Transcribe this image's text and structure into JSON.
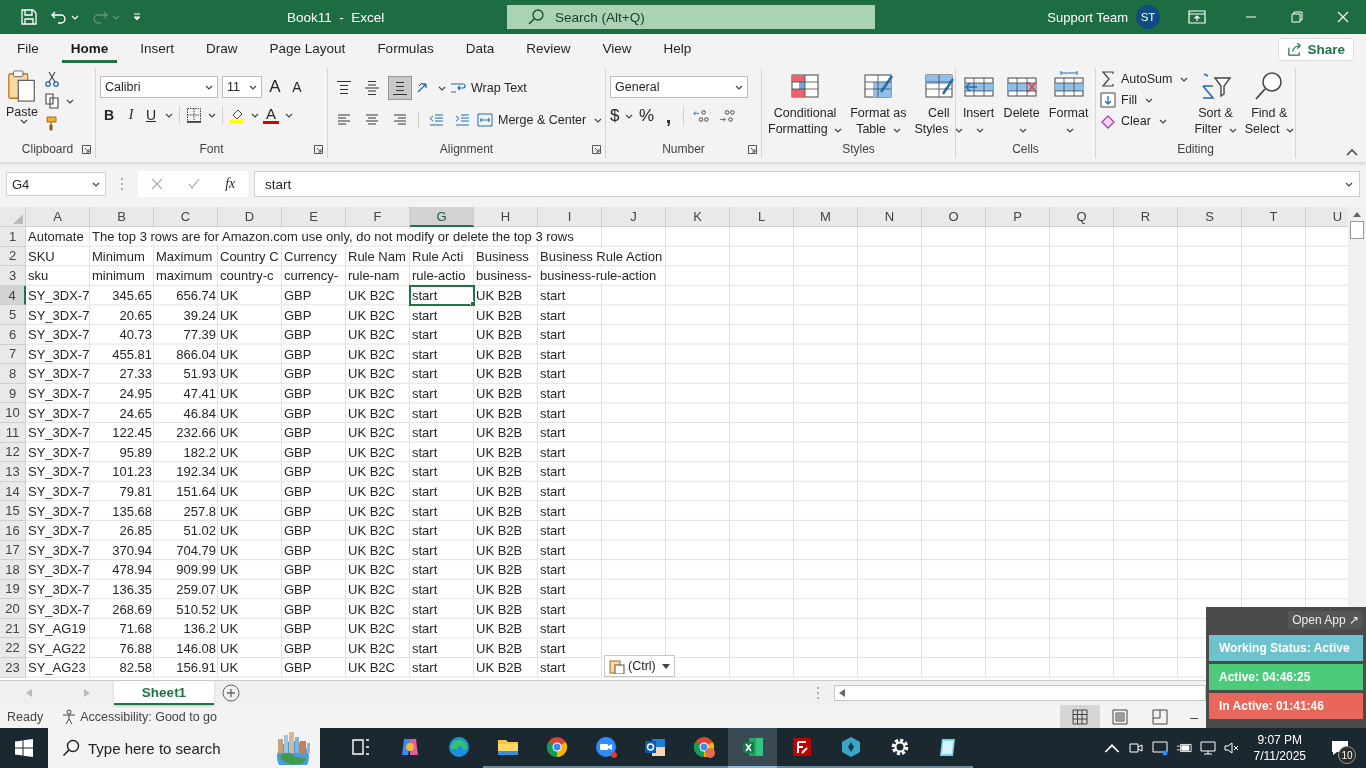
{
  "title_bar": {
    "redo_disabled": true,
    "title": "Book11  -  Excel",
    "search": {
      "placeholder": "Search (Alt+Q)"
    },
    "account": "Support Team",
    "avatar": "ST"
  },
  "ribbon_tabs": [
    {
      "label": "File",
      "selected": false
    },
    {
      "label": "Home",
      "selected": true
    },
    {
      "label": "Insert",
      "selected": false
    },
    {
      "label": "Draw",
      "selected": false
    },
    {
      "label": "Page Layout",
      "selected": false
    },
    {
      "label": "Formulas",
      "selected": false
    },
    {
      "label": "Data",
      "selected": false
    },
    {
      "label": "Review",
      "selected": false
    },
    {
      "label": "View",
      "selected": false
    },
    {
      "label": "Help",
      "selected": false
    }
  ],
  "share": "Share",
  "clipboard": {
    "label": "Clipboard",
    "paste": "Paste"
  },
  "font": {
    "label": "Font",
    "name": "Calibri",
    "size": "11",
    "grow": "A",
    "shrink": "A",
    "bold": "B",
    "italic": "I",
    "underline": "U",
    "font_color": "A"
  },
  "alignment": {
    "label": "Alignment",
    "align_buttons": [
      {
        "kind": "top",
        "selected": false
      },
      {
        "kind": "middle",
        "selected": false
      },
      {
        "kind": "bottom",
        "selected": true
      },
      {
        "kind": "left",
        "selected": false
      },
      {
        "kind": "center",
        "selected": false
      },
      {
        "kind": "right",
        "selected": false
      }
    ],
    "wrap": "Wrap Text",
    "merge": "Merge & Center"
  },
  "number": {
    "label": "Number",
    "format": "General",
    "currency": "$",
    "percent": "%",
    "comma": ","
  },
  "styles": {
    "label": "Styles",
    "buttons": [
      {
        "kind": "conditional",
        "lines": [
          "Conditional",
          "Formatting"
        ]
      },
      {
        "kind": "table",
        "lines": [
          "Format as",
          "Table"
        ]
      },
      {
        "kind": "cell_styles",
        "lines": [
          "Cell",
          "Styles"
        ]
      }
    ]
  },
  "cells": {
    "label": "Cells",
    "buttons": [
      {
        "kind": "insert",
        "label": "Insert"
      },
      {
        "kind": "delete",
        "label": "Delete"
      },
      {
        "kind": "format",
        "label": "Format"
      }
    ]
  },
  "editing": {
    "label": "Editing",
    "small": [
      {
        "kind": "autosum",
        "label": "AutoSum"
      },
      {
        "kind": "fill",
        "label": "Fill"
      },
      {
        "kind": "clear",
        "label": "Clear"
      }
    ],
    "large": [
      {
        "kind": "sort",
        "lines": [
          "Sort &",
          "Filter"
        ]
      },
      {
        "kind": "find",
        "lines": [
          "Find &",
          "Select"
        ]
      }
    ]
  },
  "formula_bar": {
    "name_box": "G4",
    "fx": "fx",
    "value": "start"
  },
  "columns": [
    {
      "label": "A",
      "selected": false
    },
    {
      "label": "B",
      "selected": false
    },
    {
      "label": "C",
      "selected": false
    },
    {
      "label": "D",
      "selected": false
    },
    {
      "label": "E",
      "selected": false
    },
    {
      "label": "F",
      "selected": false
    },
    {
      "label": "G",
      "selected": true
    },
    {
      "label": "H",
      "selected": false
    },
    {
      "label": "I",
      "selected": false
    },
    {
      "label": "J",
      "selected": false
    },
    {
      "label": "K",
      "selected": false
    },
    {
      "label": "L",
      "selected": false
    },
    {
      "label": "M",
      "selected": false
    },
    {
      "label": "N",
      "selected": false
    },
    {
      "label": "O",
      "selected": false
    },
    {
      "label": "P",
      "selected": false
    },
    {
      "label": "Q",
      "selected": false
    },
    {
      "label": "R",
      "selected": false
    },
    {
      "label": "S",
      "selected": false
    },
    {
      "label": "T",
      "selected": false
    },
    {
      "label": "U",
      "selected": false
    }
  ],
  "rows": [
    {
      "number": "1",
      "selected": false,
      "kind": "text",
      "cells": [
        "Automate",
        "The top 3 rows are for Amazon.com use only, do not modify or delete the top 3 rows"
      ]
    },
    {
      "number": "2",
      "selected": false,
      "kind": "text",
      "cells": [
        "SKU",
        "Minimum",
        "Maximum",
        "Country C",
        "Currency",
        "Rule Nam",
        "Rule Acti",
        "Business",
        "Business Rule Action"
      ]
    },
    {
      "number": "3",
      "selected": false,
      "kind": "text",
      "cells": [
        "sku",
        "minimum",
        "maximum",
        "country-c",
        "currency-",
        "rule-nam",
        "rule-actio",
        "business-",
        "business-rule-action"
      ]
    },
    {
      "number": "4",
      "selected": true,
      "kind": "data",
      "cells": [
        "SY_3DX-7",
        "345.65",
        "656.74",
        "UK",
        "GBP",
        "UK B2C",
        "start",
        "UK B2B",
        "start"
      ]
    },
    {
      "number": "5",
      "selected": false,
      "kind": "data",
      "cells": [
        "SY_3DX-7",
        "20.65",
        "39.24",
        "UK",
        "GBP",
        "UK B2C",
        "start",
        "UK B2B",
        "start"
      ]
    },
    {
      "number": "6",
      "selected": false,
      "kind": "data",
      "cells": [
        "SY_3DX-7",
        "40.73",
        "77.39",
        "UK",
        "GBP",
        "UK B2C",
        "start",
        "UK B2B",
        "start"
      ]
    },
    {
      "number": "7",
      "selected": false,
      "kind": "data",
      "cells": [
        "SY_3DX-7",
        "455.81",
        "866.04",
        "UK",
        "GBP",
        "UK B2C",
        "start",
        "UK B2B",
        "start"
      ]
    },
    {
      "number": "8",
      "selected": false,
      "kind": "data",
      "cells": [
        "SY_3DX-7",
        "27.33",
        "51.93",
        "UK",
        "GBP",
        "UK B2C",
        "start",
        "UK B2B",
        "start"
      ]
    },
    {
      "number": "9",
      "selected": false,
      "kind": "data",
      "cells": [
        "SY_3DX-7",
        "24.95",
        "47.41",
        "UK",
        "GBP",
        "UK B2C",
        "start",
        "UK B2B",
        "start"
      ]
    },
    {
      "number": "10",
      "selected": false,
      "kind": "data",
      "cells": [
        "SY_3DX-7",
        "24.65",
        "46.84",
        "UK",
        "GBP",
        "UK B2C",
        "start",
        "UK B2B",
        "start"
      ]
    },
    {
      "number": "11",
      "selected": false,
      "kind": "data",
      "cells": [
        "SY_3DX-7",
        "122.45",
        "232.66",
        "UK",
        "GBP",
        "UK B2C",
        "start",
        "UK B2B",
        "start"
      ]
    },
    {
      "number": "12",
      "selected": false,
      "kind": "data",
      "cells": [
        "SY_3DX-7",
        "95.89",
        "182.2",
        "UK",
        "GBP",
        "UK B2C",
        "start",
        "UK B2B",
        "start"
      ]
    },
    {
      "number": "13",
      "selected": false,
      "kind": "data",
      "cells": [
        "SY_3DX-7",
        "101.23",
        "192.34",
        "UK",
        "GBP",
        "UK B2C",
        "start",
        "UK B2B",
        "start"
      ]
    },
    {
      "number": "14",
      "selected": false,
      "kind": "data",
      "cells": [
        "SY_3DX-7",
        "79.81",
        "151.64",
        "UK",
        "GBP",
        "UK B2C",
        "start",
        "UK B2B",
        "start"
      ]
    },
    {
      "number": "15",
      "selected": false,
      "kind": "data",
      "cells": [
        "SY_3DX-7",
        "135.68",
        "257.8",
        "UK",
        "GBP",
        "UK B2C",
        "start",
        "UK B2B",
        "start"
      ]
    },
    {
      "number": "16",
      "selected": false,
      "kind": "data",
      "cells": [
        "SY_3DX-7",
        "26.85",
        "51.02",
        "UK",
        "GBP",
        "UK B2C",
        "start",
        "UK B2B",
        "start"
      ]
    },
    {
      "number": "17",
      "selected": false,
      "kind": "data",
      "cells": [
        "SY_3DX-7",
        "370.94",
        "704.79",
        "UK",
        "GBP",
        "UK B2C",
        "start",
        "UK B2B",
        "start"
      ]
    },
    {
      "number": "18",
      "selected": false,
      "kind": "data",
      "cells": [
        "SY_3DX-7",
        "478.94",
        "909.99",
        "UK",
        "GBP",
        "UK B2C",
        "start",
        "UK B2B",
        "start"
      ]
    },
    {
      "number": "19",
      "selected": false,
      "kind": "data",
      "cells": [
        "SY_3DX-7",
        "136.35",
        "259.07",
        "UK",
        "GBP",
        "UK B2C",
        "start",
        "UK B2B",
        "start"
      ]
    },
    {
      "number": "20",
      "selected": false,
      "kind": "data",
      "cells": [
        "SY_3DX-7",
        "268.69",
        "510.52",
        "UK",
        "GBP",
        "UK B2C",
        "start",
        "UK B2B",
        "start"
      ]
    },
    {
      "number": "21",
      "selected": false,
      "kind": "data",
      "cells": [
        "SY_AG19",
        "71.68",
        "136.2",
        "UK",
        "GBP",
        "UK B2C",
        "start",
        "UK B2B",
        "start"
      ]
    },
    {
      "number": "22",
      "selected": false,
      "kind": "data",
      "cells": [
        "SY_AG22",
        "76.88",
        "146.08",
        "UK",
        "GBP",
        "UK B2C",
        "start",
        "UK B2B",
        "start"
      ]
    },
    {
      "number": "23",
      "selected": false,
      "kind": "data",
      "cells": [
        "SY_AG23",
        "82.58",
        "156.91",
        "UK",
        "GBP",
        "UK B2C",
        "start",
        "UK B2B",
        "start"
      ]
    }
  ],
  "paste_options": "(Ctrl)",
  "sheet_tabs": [
    {
      "label": "Sheet1",
      "selected": true
    }
  ],
  "status_bar": {
    "ready": "Ready",
    "accessibility": "Accessibility: Good to go",
    "zoom_out": "–"
  },
  "tracker": {
    "open_app": "Open App ↗",
    "status": "Working Status: Active",
    "active": "Active: 04:46:25",
    "inactive": "In Active: 01:41:46"
  },
  "taskbar": {
    "search": {
      "placeholder": "Type here to search"
    },
    "apps": [
      {
        "kind": "taskview",
        "running": false,
        "selected": false
      },
      {
        "kind": "copilot",
        "running": false,
        "selected": false
      },
      {
        "kind": "edge",
        "running": false,
        "selected": false
      },
      {
        "kind": "folder",
        "running": true,
        "selected": false
      },
      {
        "kind": "chrome",
        "running": true,
        "selected": false
      },
      {
        "kind": "zoom",
        "running": true,
        "selected": false
      },
      {
        "kind": "outlook",
        "running": true,
        "selected": false
      },
      {
        "kind": "chromeprofile",
        "running": true,
        "selected": false
      },
      {
        "kind": "excel",
        "running": true,
        "selected": true
      },
      {
        "kind": "filezilla",
        "running": true,
        "selected": false
      },
      {
        "kind": "hexagon",
        "running": true,
        "selected": false
      },
      {
        "kind": "gear",
        "running": true,
        "selected": false
      },
      {
        "kind": "notepad",
        "running": true,
        "selected": false
      }
    ],
    "time": "9:07 PM",
    "date": "7/11/2025",
    "notifications": "10"
  }
}
